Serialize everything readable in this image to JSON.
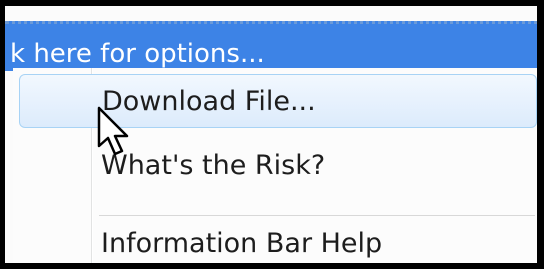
{
  "info_bar": {
    "text": "k here for options..."
  },
  "menu": {
    "items": [
      {
        "label": "Download File...",
        "hovered": true
      },
      {
        "label": "What's the Risk?",
        "hovered": false
      },
      {
        "label": "Information Bar Help",
        "hovered": false
      }
    ]
  },
  "cursor": {
    "icon": "arrow-pointer-icon"
  },
  "colors": {
    "info_bar": "#3d83e6",
    "hover_border": "#a8d3f5",
    "text": "#1d1d1d"
  }
}
